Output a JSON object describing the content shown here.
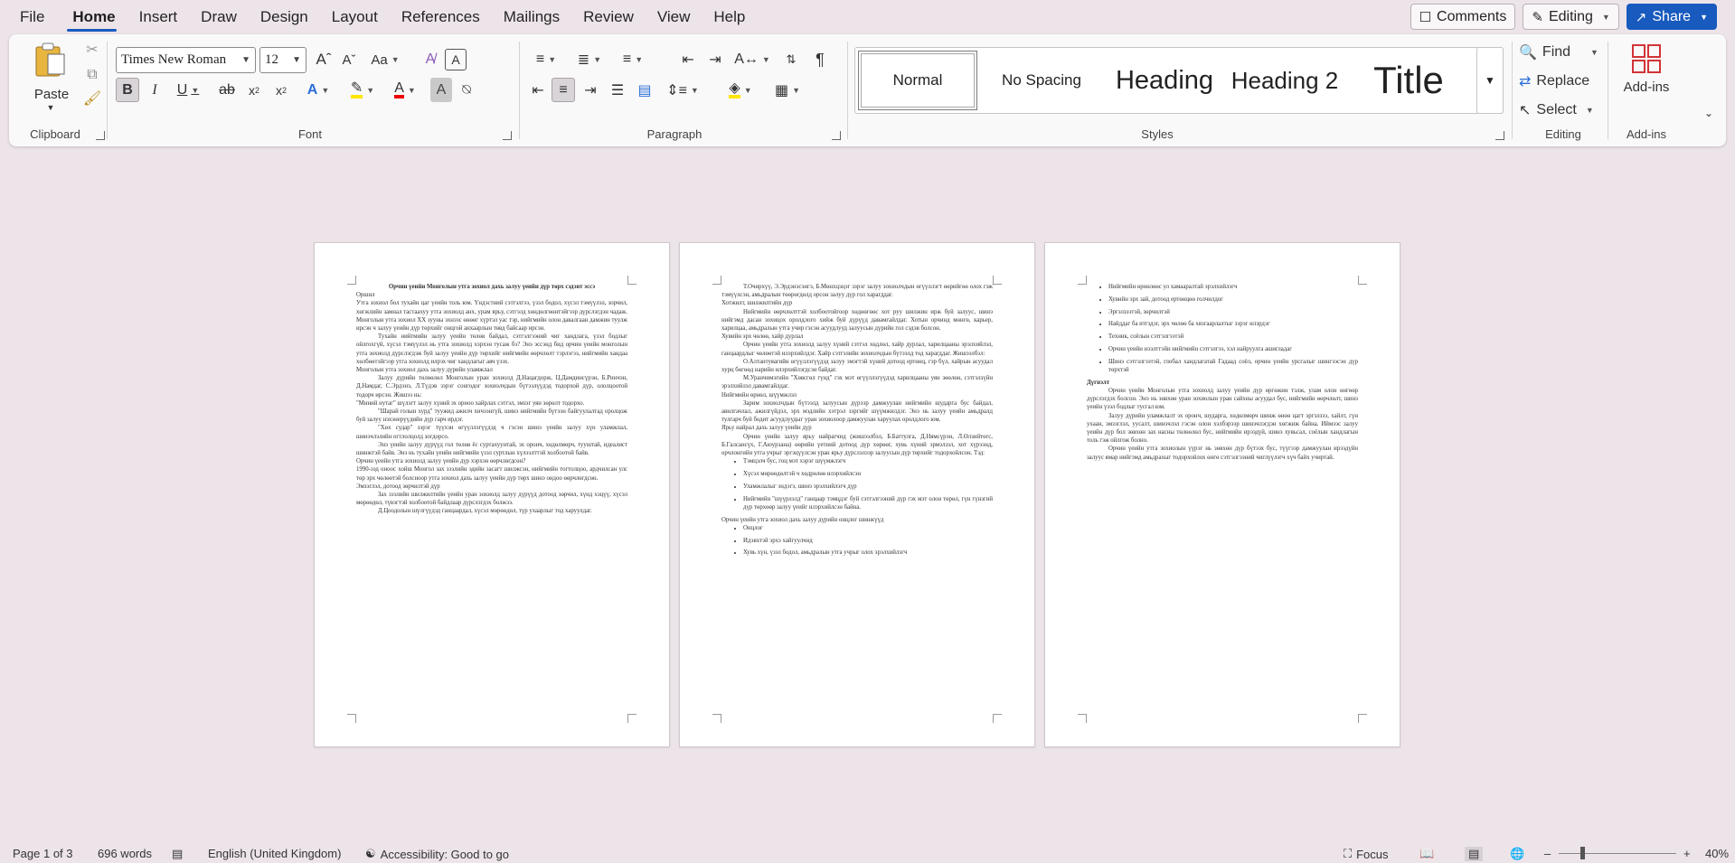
{
  "menu": {
    "tabs": [
      "File",
      "Home",
      "Insert",
      "Draw",
      "Design",
      "Layout",
      "References",
      "Mailings",
      "Review",
      "View",
      "Help"
    ],
    "active_tab": "Home",
    "comments_label": "Comments",
    "editing_label": "Editing",
    "share_label": "Share"
  },
  "ribbon": {
    "clipboard": {
      "paste_label": "Paste",
      "group_label": "Clipboard"
    },
    "font": {
      "font_name": "Times New Roman",
      "font_size": "12",
      "group_label": "Font"
    },
    "paragraph": {
      "group_label": "Paragraph"
    },
    "styles": {
      "items": [
        "Normal",
        "No Spacing",
        "Heading",
        "Heading 2",
        "Title"
      ],
      "group_label": "Styles"
    },
    "editing": {
      "find_label": "Find",
      "replace_label": "Replace",
      "select_label": "Select",
      "group_label": "Editing"
    },
    "addins": {
      "button_label": "Add-ins",
      "group_label": "Add-ins"
    }
  },
  "document": {
    "page1": {
      "title": "Орчин үеийн Монголын утга зохиол дахь залуу үеийн дүр төрх сэдэвт эссэ",
      "paragraphs": [
        {
          "style": "plain",
          "text": "Оршил"
        },
        {
          "style": "plain",
          "text": "Утга зохиол бол тухайн цаг үеийн толь юм. Үндэстний сэтгэлгээ, үзэл бодол, хүсэл тэмүүлэл, зорчил, хөгжлийн замнал тастаахуу утга зохиолд анх, урам ярьу, сэтгэлд хөндөлгөөнтэйгээр дүрслэгдэн чадаж. Монголын утга зохиол XX зууны эхнээс өнөөг хүртэл уас тэр, нийгмийн олон давалгаан дамжин туулж ирсэн ч залуу үеийн дүр төрхийг онцгой анхаарлын төвд байсаар ирсэн."
        },
        {
          "style": "ind",
          "text": "Тухайн нийгмийн залуу үеийн төлөв байдал, сэтгэлгээний чиг хандлага, үзэл бодлыг ойлгохгүй, хүсэл тэмүүлэл нь утга зохиолд хэрхэн тусаж бэ? Энэ эссэнд бид орчин үеийн монголын утга зохиолд дүрслэгдэж буй залуу үеийн дүр төрхийг нийгмийн өөрчлөлт тэрлэгээ, нийгмийн хандаа хөлбөөтэйгээр утга зохиолд илрэх чиг хандлагыг авч үзэх."
        },
        {
          "style": "plain",
          "text": "Монголын утга зохиол дахь залуу дүрийн уламжлал"
        },
        {
          "style": "ind",
          "text": "Залуу дүрийн төлөөлөл Монголын уран зохиолд Д.Нацагдорж, Ц.Дамдинсүрэн, Б.Ринчэн, Д.Намдаг, С.Эрдэнэ, Л.Түдэв зэрэг сонгодог зохиолчдын бүтээлүүдэд тодорхой дүр, ололцоотой тодорч ирсэн. Жишээ нь:"
        },
        {
          "style": "plain",
          "text": "\"Миний нутаг\" шүлэгт залуу хүний эх орноо хайрлах сэтгэл, эмзэг уян зөрөлт тодорхо."
        },
        {
          "style": "ind",
          "text": "\"Шарай голын хурд\" туужид ажилч хичээнгүй, шинэ нийгмийн бүтээн байгуулалтад оролцож буй залуу нэхэнерүүдийн дүр гарч ирдэг."
        },
        {
          "style": "ind",
          "text": "\"Хөх судар\" зэрэг түүхэн өгүүллэгүүдэд ч гэсэн шинэ үеийн залуу хүн уламжлал, шинэчлэлийн огтлолцолд зогдорсо."
        },
        {
          "style": "ind",
          "text": "Энэ үеийн залуу дүрүүд гол төлөв ёс суртахуунтай, эх оронч, хөдөлмөрч, тууштай, идеалист шинжтэй байв. Энэ нь тухайн үеийн нийгмийн үзэл суртлын хүлээлттэй холбоотой байв."
        },
        {
          "style": "plain",
          "text": "Орчин үеийн утга зохиолд залуу үеийн дүр хэрхэн өөрчлөгдсөн?"
        },
        {
          "style": "plain",
          "text": "1990-ээд оноос хойш Монгол зах зээлийн эдийн засагт шилжсэн, нийгмийн тогтолцоо, ардчилсан улс төр эрх чөлөөтэй болсноор утга зохиол дахь залуу үеийн дүр төрх шинэ ондоо өөрчлөгдсөн."
        },
        {
          "style": "plain",
          "text": "Эмзэглэл, дотоод зөрчилтэй дүр"
        },
        {
          "style": "ind",
          "text": "Зах зээлийн шилжилтийн үеийн уран зохиолд залуу дүрүүд дотоод зөрчил, хүнд хэцүү, хүсэл мөрөөдөл, түвэгтэй холбоотой байдлаар дүрслэгдэх болжээ."
        },
        {
          "style": "ind",
          "text": "Д.Цоодолын шүлгүүдэд ганцаардал, хүсэл мөрөөдөл, түр ухаарлыг тод харуулдаг."
        }
      ]
    },
    "page2": {
      "paragraphs": [
        {
          "style": "ind",
          "text": "Т.Очирхүү, Э.Эрдэнэсэнгэ, Б.Мөнхцэцэг зэрэг залуу зохиолчдын өгүүллэгт өөрийгөө олох гэж тэмүүлсэн, амьдралын төөрөгдөлд орсон залуу дүр гол харагддаг."
        },
        {
          "style": "plain",
          "text": "Хотжилт, шилжилтийн дүр"
        },
        {
          "style": "ind",
          "text": "Нийгмийн өөрчлөлттэй холбоотойгоор хөдөөгөөс хот руу шилжин ирж буй залуус, шинэ нийгэмд дасан зохицох оролдлого хийж буй дүрүүд давамгайлдаг. Хотын орчинд мөнгө, карьер, харилцаа, амьдралын утга учир гэсэн асуудлууд залуусын дүрийн гол сэдэв болсон."
        },
        {
          "style": "plain",
          "text": "Хувийн эрх чөлөө, хайр дурлал"
        },
        {
          "style": "ind",
          "text": "Орчин үеийн утга зохиолд залуу хүний сэтгэл хөдлөл, хайр дурлал, харилцааны эрэлхийлэл, ганцаардлыг чөлөөтэй илэрхийлдэг. Хайр сэтгэлийн зохиолчдын бүтээлд тод харагддаг. Жишээлбэл:"
        },
        {
          "style": "ind",
          "text": "О.Алтантуяагийн өгүүллэгүүдэд залуу эмэгтэй хүний дотоод ертөнц, гэр бүл, хайрын асуудал хурц бөгөөд нарийн илэрхийлэгдсэн байдаг."
        },
        {
          "style": "ind",
          "text": "М.Уранчимэгийн \"Хөвсгөл гүнд\" гэх мэт өгүүллэгүүдэд харилцааны уян зөөлөн, сэтгэлзүйн эрэлхийлэл давамгайлдаг."
        },
        {
          "style": "plain",
          "text": "Нийгмийн өрнөл, шүүмжлэл"
        },
        {
          "style": "ind",
          "text": "Зарим зохиолчдын бүтээлд залуусын дүрээр дамжуулан нийгмийн шударга бус байдал, авилгачлал, ажилгүйдэл, эрх мэдлийн хэтрэл зэргийг шүүмжилдэг. Энэ нь залуу үеийн амьдралд тулгарч буй бодит асуудлуудыг уран зохиолоор дамжуулан харуулах оролдлого юм."
        },
        {
          "style": "plain",
          "text": "Ярьу найрал дахь залуу үеийн дүр"
        },
        {
          "style": "ind",
          "text": "Орчин үеийн залуу ярьу найрагчид (жишээлбэл, Б.Баттулга, Д.Нямсүрэн, Л.Өлзийтөгс, Б.Галсансүх, Г.Аюурзана) өөрийн үетний дотоод дүр хөрөөг, хувь хүний эрмэлзэл, хот хүрээнд, орчлонгийн утга учрыг эргэцүүлсэн уран ярьу дүрслэлээр залуусын дүр төрхийг тодорхойлсон. Тэд:"
        },
        {
          "style": "bullet",
          "text": "Тэмцэлч бус, гоц мэт хэрэг шүүмжлэгч"
        },
        {
          "style": "bullet",
          "text": "Хүсэл мөрөөдөлтэй ч хөдрөлөө илэрхийлсэн"
        },
        {
          "style": "bullet",
          "text": "Уламжлалыг эндэгэ, шинэ эрэлхийлэгч дүр"
        },
        {
          "style": "bullet",
          "text": "Нийгмийн \"шүүрлэлд\" ганцаар тэмцдэг буй сэтгэлгээний дүр гэх мэт олон төрөл, гүн гүнзгий дүр төрхөөр залуу үеийг илэрхийлсэн байна."
        },
        {
          "style": "plain",
          "text": "Орчин үеийн утга зохиол дахь залуу дүрийн онцлог шинжүүд"
        },
        {
          "style": "bullet",
          "text": "Онцлог"
        },
        {
          "style": "bullet",
          "text": "Идэвхтэй эрхэ хайгуулчид"
        },
        {
          "style": "bullet",
          "text": "Хувь хүн, үзэл бодол, амьдралын утга учрыг олох эрэлхийлэгч"
        }
      ]
    },
    "page3": {
      "paragraphs": [
        {
          "style": "bullet",
          "text": "Нийгмийн өрнөлөөс ул хамааралтай эрэлхийлэгч"
        },
        {
          "style": "bullet",
          "text": "Хувийн эрх зай, дотоод ертөнцөө голчилдог"
        },
        {
          "style": "bullet",
          "text": "Эргэлзээтэй, зөрчилтэй"
        },
        {
          "style": "bullet",
          "text": "Найддаг ба итгэдэг, эрх чөлөө ба хязгаарлалтыг зэрэг илэрдэг"
        },
        {
          "style": "bullet",
          "text": "Техник, соёлын сэтгэлгээтэй"
        },
        {
          "style": "bullet",
          "text": "Орчин үеийн нээлттэйн нийгмийн сэтгэлгээ, хэл найруулга ашигладаг"
        },
        {
          "style": "bullet",
          "text": "Шинэ сэтгэлгээтэй, глобал хандлагатай Гадаад соёл, орчин үеийн урсгалыг шингээсэн дүр төрхтэй"
        },
        {
          "style": "bold",
          "text": "Дүгнэлт"
        },
        {
          "style": "ind",
          "text": "Орчин үеийн Монголын утга зохиолд залуу үеийн дүр өргөжин тэлж, улам олон өнгөөр дүрслэгдэх болсон. Энэ нь зөвхөн уран зохиолын уран сайхны асуудал бус, нийгмийн өөрчлөлт, шинэ үеийн үзэл бодлыг тусгал юм."
        },
        {
          "style": "ind",
          "text": "Залуу дүрийн уламжлалт эх оронч, шударга, хөдөлмөрч шинж өнөө цагт эргэлзээ, хайлт, гүн ухаан, эмзэглэл, уусалт, шинэчлэл гэсэн олон хэлбэрээр шинэчлэгдэн хөгжиж байна. Иймээс залуу үеийн дүр бол зөвхөн зах насны төлөөлөл бус, нийгмийн ирээдүй, шинэ хувьсал, соёлын хандлагын толь гэж ойлгож болно."
        },
        {
          "style": "ind",
          "text": "Орчин үеийн утга зохиолын үүрэг нь зөвхөн дүр бүтээх бус, түүгээр дамжуулан ирээдүйн залуус ямар нийгэмд амьдрахыг тодорхойлох өнгө сэтгэлгээний чиглүүлэгч хүч байх учиртай."
        }
      ]
    }
  },
  "status": {
    "page": "Page 1 of 3",
    "words": "696 words",
    "language": "English (United Kingdom)",
    "accessibility": "Accessibility: Good to go",
    "focus": "Focus",
    "zoom": "40%"
  }
}
